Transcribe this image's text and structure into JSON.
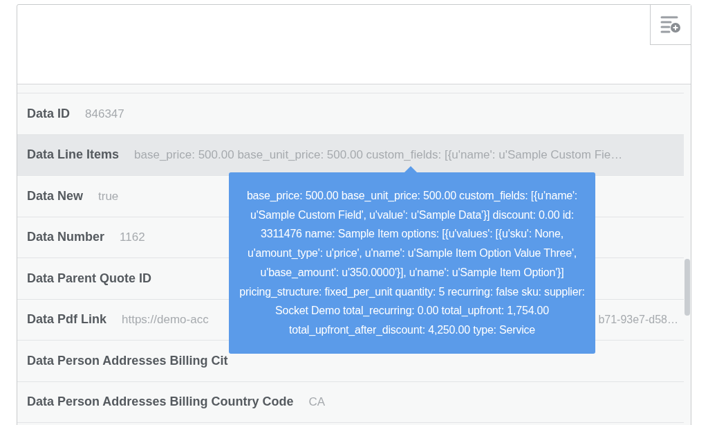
{
  "rows": [
    {
      "label": "Data ID",
      "value": "846347",
      "selected": false
    },
    {
      "label": "Data Line Items",
      "value": "base_price: 500.00 base_unit_price: 500.00 custom_fields: [{u'name': u'Sample Custom Fie…",
      "selected": true
    },
    {
      "label": "Data New",
      "value": "true",
      "selected": false
    },
    {
      "label": "Data Number",
      "value": "1162",
      "selected": false
    },
    {
      "label": "Data Parent Quote ID",
      "selected": false
    },
    {
      "label": "Data Pdf Link",
      "value": "https://demo-acc",
      "value_right": "b71-93e7-d58…",
      "selected": false
    },
    {
      "label": "Data Person Addresses Billing Cit",
      "selected": false
    },
    {
      "label": "Data Person Addresses Billing Country Code",
      "value": "CA",
      "selected": false
    }
  ],
  "tooltip": {
    "text": "base_price: 500.00 base_unit_price: 500.00 custom_fields: [{u'name': u'Sample Custom Field', u'value': u'Sample Data'}] discount: 0.00 id: 3311476 name: Sample Item options: [{u'values': [{u'sku': None, u'amount_type': u'price', u'name': u'Sample Item Option Value Three', u'base_amount': u'350.0000'}], u'name': u'Sample Item Option'}] pricing_structure: fixed_per_unit quantity: 5 recurring: false sku: supplier: Socket Demo total_recurring: 0.00 total_upfront: 1,754.00 total_upfront_after_discount: 4,250.00 type: Service"
  }
}
